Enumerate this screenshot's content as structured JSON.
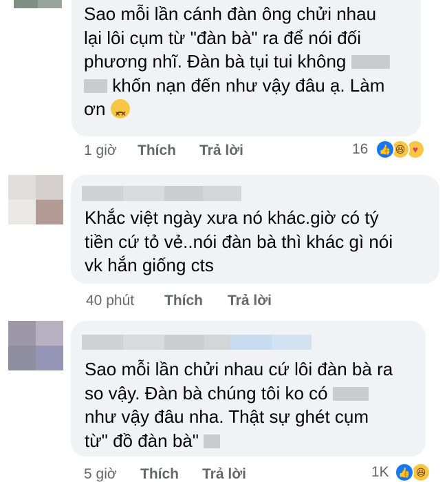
{
  "comments": [
    {
      "lines": [
        "Sao mỗi lần cánh đàn ông chửi nhau",
        "lại lôi cụm từ \"đàn bà\" ra để nói đối",
        "phương nhĩ. Đàn bà tụi tui không",
        "khốn nạn đến như vậy đâu ạ. Làm",
        "ơn"
      ],
      "time": "1 giờ",
      "like_label": "Thích",
      "reply_label": "Trả lời",
      "reaction_count": "16",
      "reaction_icons": [
        "like-icon",
        "haha-icon",
        "care-icon"
      ]
    },
    {
      "lines": [
        "Khắc việt ngày xưa nó khác.giờ có tý",
        "tiền cứ tỏ vẻ..nói đàn bà thì khác gì nói",
        "vk hắn giống cts"
      ],
      "time": "40 phút",
      "like_label": "Thích",
      "reply_label": "Trả lời"
    },
    {
      "lines": [
        "Sao mỗi lần chửi nhau cứ lôi đàn bà ra",
        "so vậy. Đàn bà chúng tôi ko có",
        "như vậy đâu nha. Thật sự ghét cụm",
        "từ\" đồ đàn bà\""
      ],
      "time": "5 giờ",
      "like_label": "Thích",
      "reply_label": "Trả lời",
      "reaction_count": "1K",
      "reaction_icons": [
        "like-icon",
        "haha-icon"
      ]
    }
  ],
  "colors": {
    "bubble": "#f0f2f5",
    "text": "#050505",
    "meta": "#65676b",
    "like": "#1877f2",
    "emoji": "#f7c744"
  }
}
